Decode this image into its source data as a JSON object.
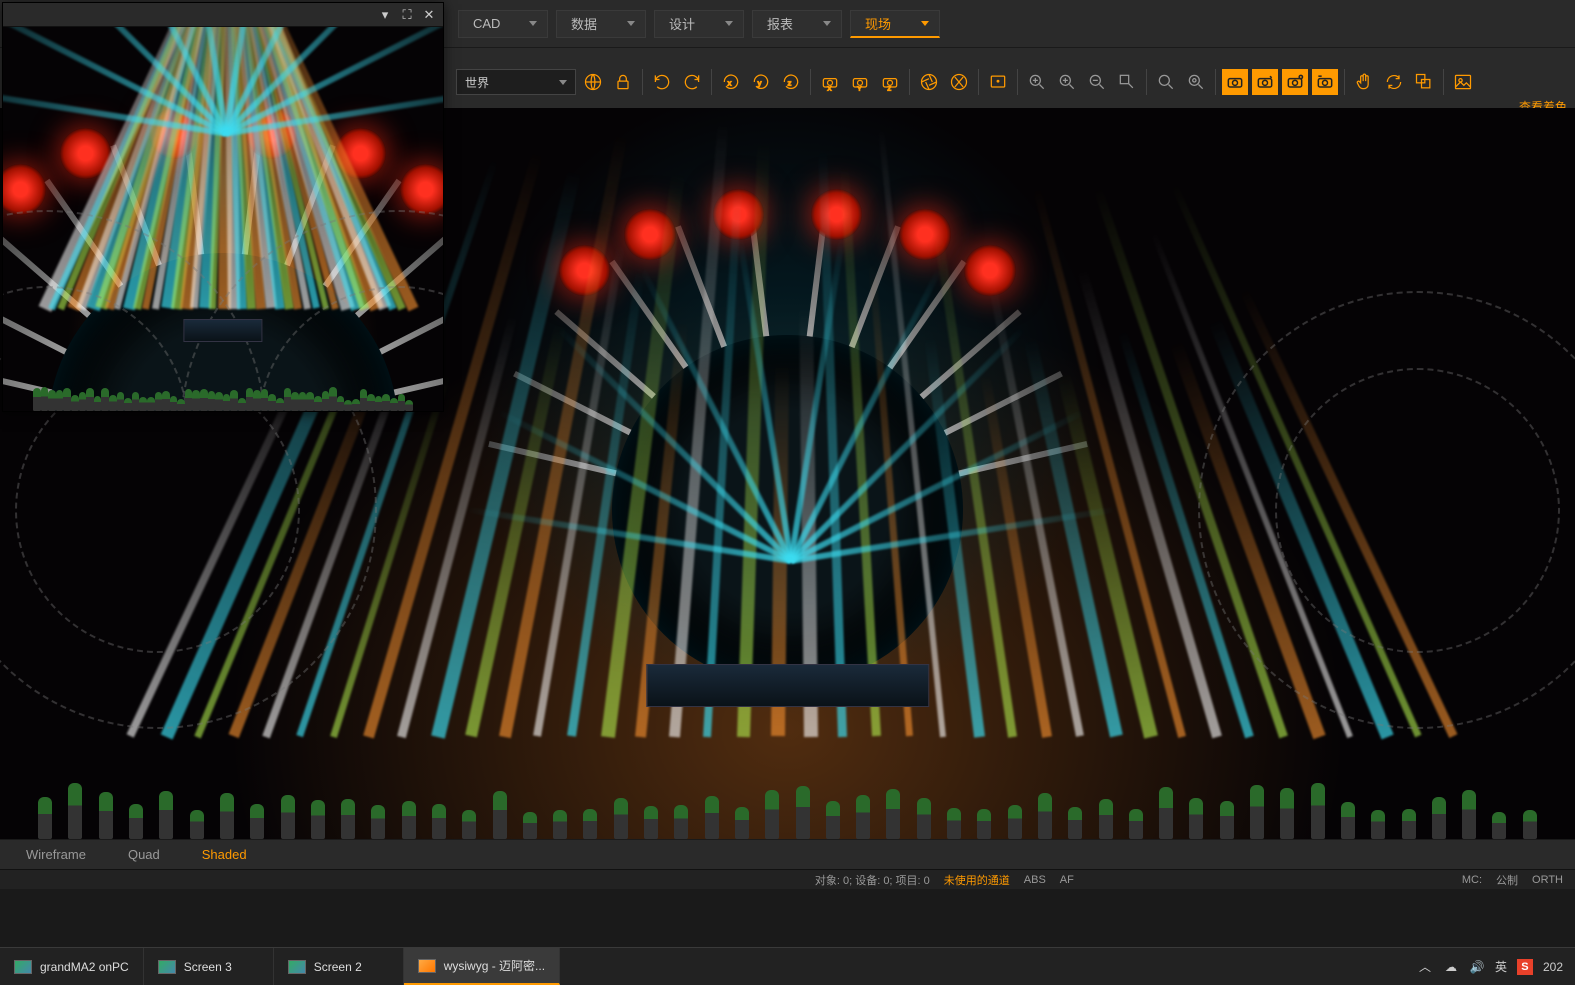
{
  "menu": {
    "items": [
      {
        "label": "CAD",
        "active": false
      },
      {
        "label": "数据",
        "active": false
      },
      {
        "label": "设计",
        "active": false
      },
      {
        "label": "报表",
        "active": false
      },
      {
        "label": "现场",
        "active": true
      }
    ]
  },
  "toolbar": {
    "world_dropdown": "世界",
    "corner_label": "查看着色"
  },
  "view_tabs": [
    {
      "label": "Wireframe",
      "active": false
    },
    {
      "label": "Quad",
      "active": false
    },
    {
      "label": "Shaded",
      "active": true
    }
  ],
  "status": {
    "objects": "对象: 0; 设备: 0; 项目: 0",
    "channels": "未使用的通道",
    "abs": "ABS",
    "af": "AF",
    "mc": "MC:",
    "pub": "公制",
    "orth": "ORTH"
  },
  "taskbar": {
    "items": [
      {
        "label": "grandMA2 onPC",
        "active": false,
        "icon": "green"
      },
      {
        "label": "Screen 3",
        "active": false,
        "icon": "green"
      },
      {
        "label": "Screen 2",
        "active": false,
        "icon": "green"
      },
      {
        "label": "wysiwyg - 迈阿密...",
        "active": true,
        "icon": "orange"
      }
    ],
    "tray": {
      "ime": "英",
      "s": "S",
      "clock": "202"
    }
  },
  "overlay": {
    "minimize": "▾",
    "maximize": "⛶",
    "close": "✕"
  }
}
